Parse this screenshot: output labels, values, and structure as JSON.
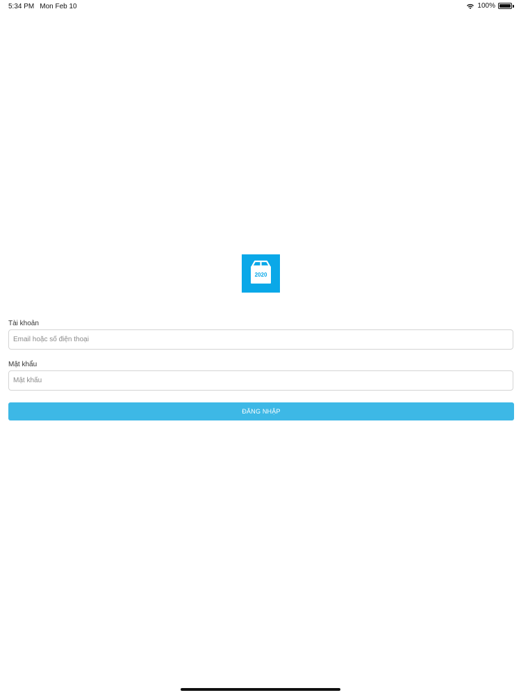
{
  "status_bar": {
    "time": "5:34 PM",
    "date": "Mon Feb 10",
    "battery_text": "100%",
    "battery_level": 1.0
  },
  "logo": {
    "year": "2020",
    "icon": "box-icon",
    "color": "#0aa8e8"
  },
  "form": {
    "account_label": "Tài khoản",
    "account_placeholder": "Email hoặc số điện thoại",
    "account_value": "",
    "password_label": "Mật khẩu",
    "password_placeholder": "Mật khẩu",
    "password_value": "",
    "login_button_label": "ĐĂNG NHẬP",
    "button_color": "#3db8e6"
  }
}
